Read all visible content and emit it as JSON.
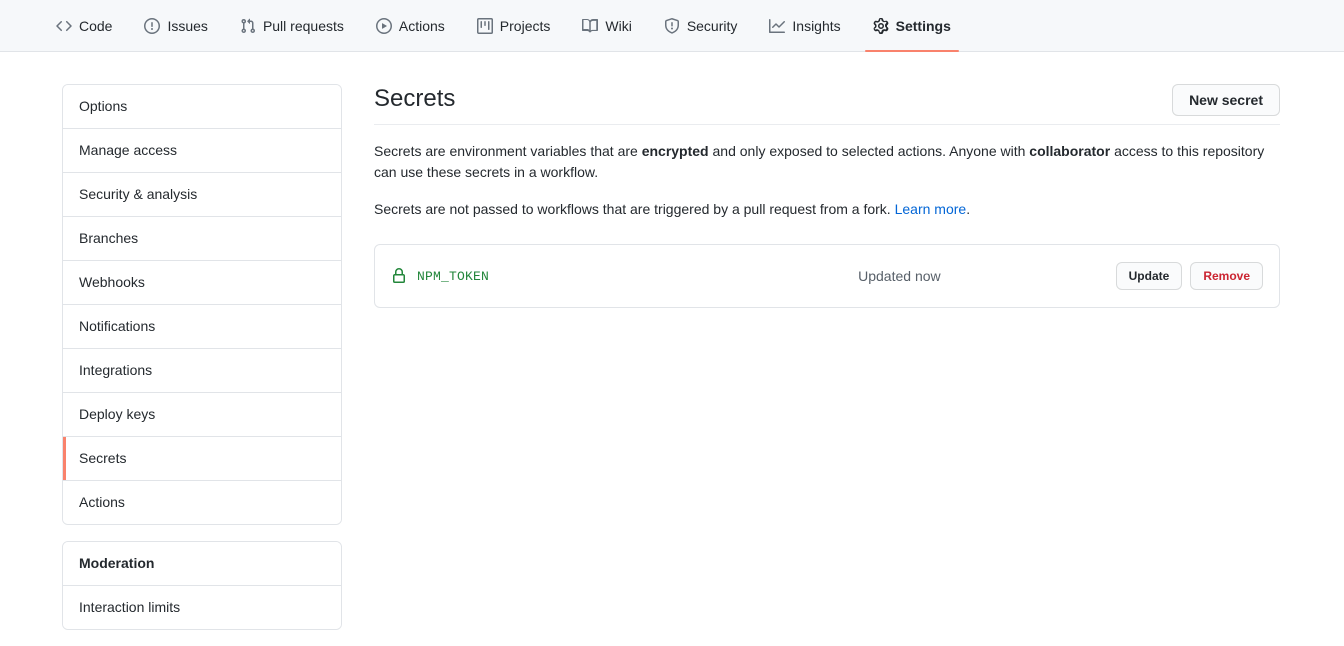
{
  "repo_nav": {
    "items": [
      {
        "label": "Code",
        "icon": "code-icon",
        "selected": false
      },
      {
        "label": "Issues",
        "icon": "issue-opened-icon",
        "selected": false
      },
      {
        "label": "Pull requests",
        "icon": "git-pull-request-icon",
        "selected": false
      },
      {
        "label": "Actions",
        "icon": "play-icon",
        "selected": false
      },
      {
        "label": "Projects",
        "icon": "project-board-icon",
        "selected": false
      },
      {
        "label": "Wiki",
        "icon": "book-icon",
        "selected": false
      },
      {
        "label": "Security",
        "icon": "shield-icon",
        "selected": false
      },
      {
        "label": "Insights",
        "icon": "graph-icon",
        "selected": false
      },
      {
        "label": "Settings",
        "icon": "gear-icon",
        "selected": true
      }
    ],
    "selected_underline_color": "#f9826c"
  },
  "sidebar": {
    "groups": [
      {
        "items": [
          {
            "label": "Options",
            "active": false,
            "heading": false
          },
          {
            "label": "Manage access",
            "active": false,
            "heading": false
          },
          {
            "label": "Security & analysis",
            "active": false,
            "heading": false
          },
          {
            "label": "Branches",
            "active": false,
            "heading": false
          },
          {
            "label": "Webhooks",
            "active": false,
            "heading": false
          },
          {
            "label": "Notifications",
            "active": false,
            "heading": false
          },
          {
            "label": "Integrations",
            "active": false,
            "heading": false
          },
          {
            "label": "Deploy keys",
            "active": false,
            "heading": false
          },
          {
            "label": "Secrets",
            "active": true,
            "heading": false
          },
          {
            "label": "Actions",
            "active": false,
            "heading": false
          }
        ]
      },
      {
        "items": [
          {
            "label": "Moderation",
            "active": false,
            "heading": true
          },
          {
            "label": "Interaction limits",
            "active": false,
            "heading": false
          }
        ]
      }
    ],
    "active_marker_color": "#f9826c"
  },
  "main": {
    "title": "Secrets",
    "new_secret_button": "New secret",
    "description_1": {
      "part_1": "Secrets are environment variables that are ",
      "bold_1": "encrypted",
      "part_2": " and only exposed to selected actions. Anyone with ",
      "bold_2": "collaborator",
      "part_3": " access to this repository can use these secrets in a workflow."
    },
    "description_2": {
      "part_1": "Secrets are not passed to workflows that are triggered by a pull request from a fork. ",
      "link_label": "Learn more",
      "part_2": "."
    },
    "link_color": "#0366d6",
    "secrets": [
      {
        "name": "NPM_TOKEN",
        "icon": "lock-icon",
        "name_color": "#22863a",
        "updated": "Updated now",
        "update_label": "Update",
        "remove_label": "Remove"
      }
    ],
    "danger_color": "#cb2431"
  }
}
